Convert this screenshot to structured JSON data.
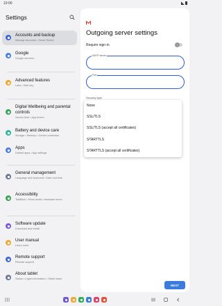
{
  "status_bar": {
    "time": "10:00"
  },
  "sidebar": {
    "title": "Settings",
    "items": [
      {
        "label": "Accounts and backup",
        "sub": "Manage accounts • Smart Switch",
        "icon": "accounts-backup-icon",
        "color": "#3f6bd8"
      },
      {
        "label": "Google",
        "sub": "Google services",
        "icon": "google-icon",
        "color": "#4a80e8"
      },
      {
        "label": "Advanced features",
        "sub": "Labs • Side key",
        "icon": "advanced-features-icon",
        "color": "#f0a830"
      },
      {
        "label": "Digital Wellbeing and parental controls",
        "sub": "Screen time • App timers",
        "icon": "wellbeing-icon",
        "color": "#3aa655"
      },
      {
        "label": "Battery and device care",
        "sub": "Storage • Memory • Device protection",
        "icon": "device-care-icon",
        "color": "#2eb89c"
      },
      {
        "label": "Apps",
        "sub": "Default apps • App settings",
        "icon": "apps-icon",
        "color": "#4a7fe3"
      },
      {
        "label": "General management",
        "sub": "Language and keyboard • Date and time",
        "icon": "general-management-icon",
        "color": "#6f7d92"
      },
      {
        "label": "Accessibility",
        "sub": "TalkBack • Mono audio • Assistant menu",
        "icon": "accessibility-icon",
        "color": "#3aa655"
      },
      {
        "label": "Software update",
        "sub": "Download and install",
        "icon": "software-update-icon",
        "color": "#7a5ae0"
      },
      {
        "label": "User manual",
        "sub": "Learn more",
        "icon": "user-manual-icon",
        "color": "#f0a830"
      },
      {
        "label": "Remote support",
        "sub": "Remote support",
        "icon": "remote-support-icon",
        "color": "#3f6bd8"
      },
      {
        "label": "About tablet",
        "sub": "Status • Legal information • Tablet name",
        "icon": "about-tablet-icon",
        "color": "#6f7d92"
      }
    ]
  },
  "page": {
    "title": "Outgoing server settings",
    "require_signin_label": "Require sign-in",
    "require_signin_on": false,
    "smtp_server_label": "SMTP server",
    "smtp_server_value": "",
    "port_label": "Port",
    "port_value": "",
    "security_type_label": "Security type",
    "next_label": "NEXT"
  },
  "security_dropdown": {
    "options": [
      "None",
      "SSL/TLS",
      "SSL/TLS (accept all certificates)",
      "STARTTLS",
      "STARTTLS (accept all certificates)"
    ]
  },
  "nav_bar": {
    "dock_apps": [
      {
        "icon": "phone-app-icon",
        "color": "#6b5ae0"
      },
      {
        "icon": "messages-app-icon",
        "color": "#f2a93b"
      },
      {
        "icon": "contacts-app-icon",
        "color": "#2fae5c"
      },
      {
        "icon": "chat-app-icon",
        "color": "#3b7be0"
      },
      {
        "icon": "camera-app-icon",
        "color": "#e0406b"
      },
      {
        "icon": "gallery-app-icon",
        "color": "#e2533a"
      }
    ]
  },
  "colors": {
    "accent": "#3b7be0",
    "field_border": "#2a5bd7",
    "selected_bg": "#dcdde1"
  }
}
